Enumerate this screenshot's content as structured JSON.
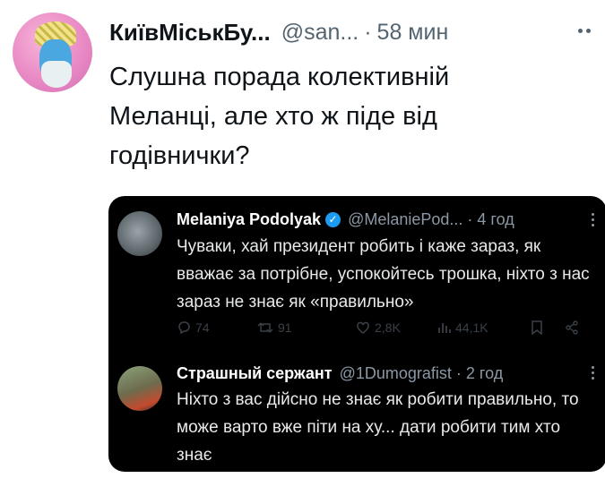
{
  "tweet": {
    "author_name": "КиївМіськБу...",
    "handle": "@san...",
    "separator": "·",
    "time": "58 мин",
    "text": "Слушна порада колективній Меланці, але хто ж піде від годівнички?"
  },
  "quoted_thread": {
    "first": {
      "author_name": "Melaniya Podolyak",
      "verified_mark": "✓",
      "handle": "@MelaniePod...",
      "separator": "·",
      "time": "4 год",
      "text": "Чуваки, хай президент робить і каже зараз, як вважає за потрібне, успокойтесь трошка, ніхто з нас зараз не знає як «правильно»",
      "stats": {
        "replies": "74",
        "reposts": "91",
        "likes": "2,8K",
        "views": "44,1K"
      }
    },
    "reply": {
      "author_name": "Страшный сержант",
      "handle": "@1Dumografist",
      "separator": "·",
      "time": "2 год",
      "text": "Ніхто з вас дійсно не знає як робити правильно, то може варто вже піти на ху... дати робити тим хто знає"
    }
  },
  "colors": {
    "text_primary": "#0f1419",
    "text_secondary": "#536471",
    "embed_bg": "#000000",
    "verified": "#1d9bf0"
  }
}
